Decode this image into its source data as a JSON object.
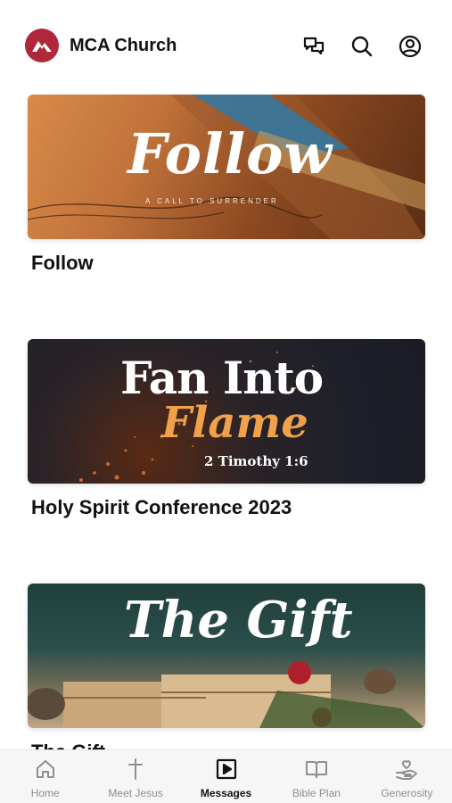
{
  "header": {
    "title": "MCA Church",
    "logo_icon": "mountain-logo-icon",
    "icons": [
      "chat-icon",
      "search-icon",
      "account-icon"
    ]
  },
  "cards": [
    {
      "title": "Follow",
      "banner_text": "Follow",
      "banner_subtitle": "A CALL TO SURRENDER"
    },
    {
      "title": "Holy Spirit Conference 2023",
      "banner_text_line1": "Fan Into",
      "banner_text_line2": "Flame",
      "banner_subtitle": "2 Timothy 1:6"
    },
    {
      "title": "The Gift",
      "banner_text": "The Gift"
    }
  ],
  "tabbar": {
    "active": "Messages",
    "tabs": [
      {
        "label": "Home",
        "icon": "home-icon"
      },
      {
        "label": "Meet Jesus",
        "icon": "cross-icon"
      },
      {
        "label": "Messages",
        "icon": "play-icon"
      },
      {
        "label": "Bible Plan",
        "icon": "book-icon"
      },
      {
        "label": "Generosity",
        "icon": "giving-hand-icon"
      }
    ]
  },
  "colors": {
    "brand": "#b0273a",
    "active_tab": "#111111",
    "inactive_tab": "#8f8f8f",
    "fan_flame": "#f0a24a"
  }
}
